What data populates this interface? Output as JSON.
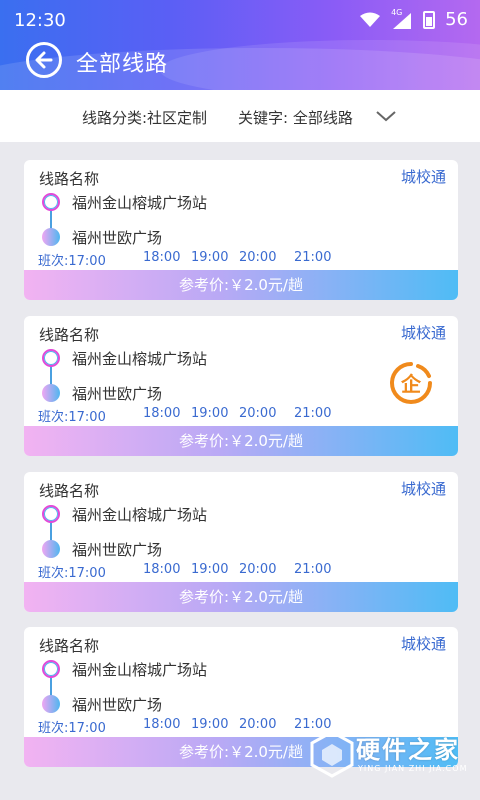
{
  "status": {
    "time": "12:30",
    "network": "4G",
    "battery": "56"
  },
  "header": {
    "title": "全部线路",
    "back_icon": "arrow-left-icon"
  },
  "filter": {
    "category": "线路分类:社区定制",
    "keyword": "关键字: 全部线路",
    "dropdown_icon": "chevron-down-icon"
  },
  "routes": [
    {
      "name": "线路名称",
      "type": "城校通",
      "start": "福州金山榕城广场站",
      "end": "福州世欧广场",
      "schedule_label": "班次:17:00",
      "times": [
        "18:00",
        "19:00",
        "20:00",
        "21:00"
      ],
      "price": "参考价:￥2.0元/趟",
      "enterprise_badge": ""
    },
    {
      "name": "线路名称",
      "type": "城校通",
      "start": "福州金山榕城广场站",
      "end": "福州世欧广场",
      "schedule_label": "班次:17:00",
      "times": [
        "18:00",
        "19:00",
        "20:00",
        "21:00"
      ],
      "price": "参考价:￥2.0元/趟",
      "enterprise_badge": "企"
    },
    {
      "name": "线路名称",
      "type": "城校通",
      "start": "福州金山榕城广场站",
      "end": "福州世欧广场",
      "schedule_label": "班次:17:00",
      "times": [
        "18:00",
        "19:00",
        "20:00",
        "21:00"
      ],
      "price": "参考价:￥2.0元/趟",
      "enterprise_badge": ""
    },
    {
      "name": "线路名称",
      "type": "城校通",
      "start": "福州金山榕城广场站",
      "end": "福州世欧广场",
      "schedule_label": "班次:17:00",
      "times": [
        "18:00",
        "19:00",
        "20:00",
        "21:00"
      ],
      "price": "参考价:￥2.0元/趟",
      "enterprise_badge": ""
    }
  ],
  "watermark": {
    "title": "硬件之家",
    "subtitle": "YING JIAN ZHI JIA.COM"
  },
  "colors": {
    "accent": "#3a6ad0",
    "badge": "#f08a1c"
  }
}
